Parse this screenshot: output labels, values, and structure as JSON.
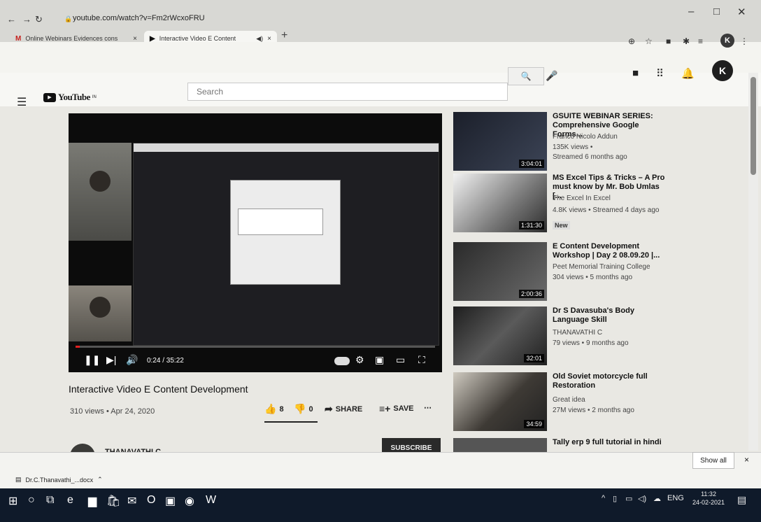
{
  "browser": {
    "tabs": [
      {
        "label": "Online Webinars Evidences cons",
        "close": "×",
        "icon": "gmail-icon"
      },
      {
        "label": "Interactive Video E Content",
        "close": "×",
        "icon": "youtube-icon"
      }
    ],
    "new_tab": "+",
    "url": "youtube.com/watch?v=Fm2rWcxoFRU"
  },
  "youtube": {
    "logo": "YouTube",
    "logo_suffix": "IN",
    "search_placeholder": "Search",
    "avatar_letter": "K"
  },
  "player": {
    "time": "0:24 / 35:22",
    "progress": 0.011
  },
  "video": {
    "title": "Interactive Video E Content Development",
    "stats": "310 views • Apr 24, 2020",
    "likes": "8",
    "dislikes": "0",
    "share": "SHARE",
    "save": "SAVE",
    "more": "⋯",
    "channel": "THANAVATHI C",
    "subscribe": "SUBSCRIBE"
  },
  "recommendations": [
    {
      "title": "GSUITE WEBINAR SERIES: Comprehensive Google Forms...",
      "channel": "Franco Nicolo Addun",
      "meta": "135K views •",
      "meta2": "Streamed 6 months ago",
      "duration": "3:04:01"
    },
    {
      "title": "MS Excel Tips & Tricks – A Pro must know by Mr. Bob Umlas [...",
      "channel": "The Excel In Excel",
      "meta": "4.8K views • Streamed 4 days ago",
      "badge": "New",
      "duration": "1:31:30"
    },
    {
      "title": "E Content Development Workshop | Day 2 08.09.20 |...",
      "channel": "Peet Memorial Training College",
      "meta": "304 views • 5 months ago",
      "duration": "2:00:36"
    },
    {
      "title": "Dr S Davasuba's Body Language Skill",
      "channel": "THANAVATHI C",
      "meta": "79 views • 9 months ago",
      "duration": "32:01"
    },
    {
      "title": "Old Soviet motorcycle full Restoration",
      "channel": "Great idea",
      "meta": "27M views • 2 months ago",
      "duration": "34:59"
    },
    {
      "title": "Tally erp 9 full tutorial in hindi",
      "channel": "",
      "meta": "",
      "duration": ""
    }
  ],
  "download": {
    "file": "Dr.C.Thanavathi_...docx",
    "show_all": "Show all",
    "close": "×"
  },
  "taskbar": {
    "lang": "ENG",
    "time": "11:32",
    "date": "24-02-2021"
  }
}
